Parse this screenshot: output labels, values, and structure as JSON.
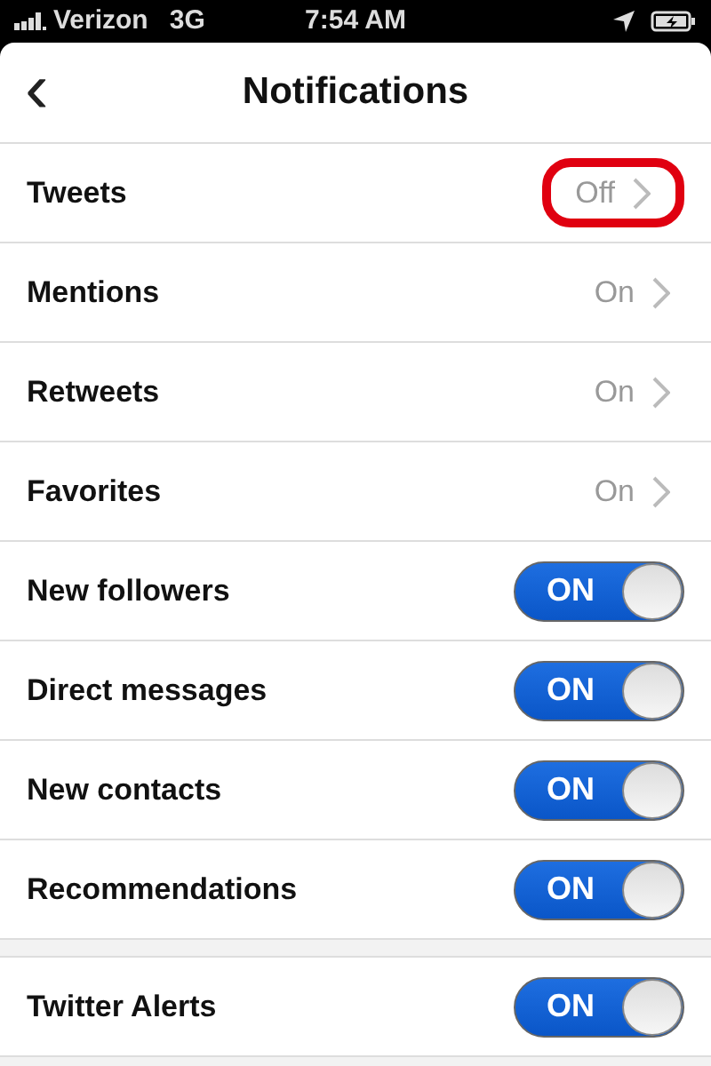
{
  "status_bar": {
    "carrier": "Verizon",
    "network": "3G",
    "time": "7:54 AM"
  },
  "nav": {
    "back": "‹",
    "title": "Notifications"
  },
  "sections": [
    {
      "rows": [
        {
          "kind": "disclosure",
          "label": "Tweets",
          "value": "Off",
          "highlighted": true
        },
        {
          "kind": "disclosure",
          "label": "Mentions",
          "value": "On",
          "highlighted": false
        },
        {
          "kind": "disclosure",
          "label": "Retweets",
          "value": "On",
          "highlighted": false
        },
        {
          "kind": "disclosure",
          "label": "Favorites",
          "value": "On",
          "highlighted": false
        },
        {
          "kind": "toggle",
          "label": "New followers",
          "on": true,
          "switch_text": "ON"
        },
        {
          "kind": "toggle",
          "label": "Direct messages",
          "on": true,
          "switch_text": "ON"
        },
        {
          "kind": "toggle",
          "label": "New contacts",
          "on": true,
          "switch_text": "ON"
        },
        {
          "kind": "toggle",
          "label": "Recommendations",
          "on": true,
          "switch_text": "ON"
        }
      ]
    },
    {
      "rows": [
        {
          "kind": "toggle",
          "label": "Twitter Alerts",
          "on": true,
          "switch_text": "ON"
        }
      ]
    }
  ]
}
